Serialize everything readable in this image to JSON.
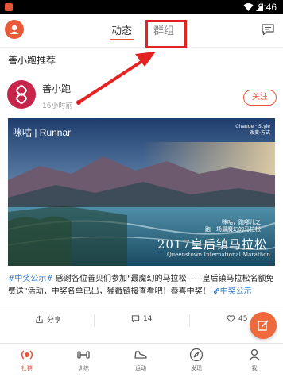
{
  "status_bar": {
    "time": "9:46"
  },
  "topbar": {
    "tabs": [
      {
        "label": "动态",
        "active": true
      },
      {
        "label": "群组",
        "active": false
      }
    ]
  },
  "section": {
    "title": "善小跑推荐"
  },
  "post": {
    "author": "善小跑",
    "time": "16小时前",
    "follow_label": "关注",
    "image": {
      "brand": "咪咕 | Runnar",
      "tagline": [
        "Change · Style",
        "改变·方式"
      ],
      "slogan": [
        "咪咕，跑哪儿之",
        "跑一场最魔幻的马拉松"
      ],
      "title": "2017皇后镇马拉松",
      "subtitle": "Queenstown International Marathon"
    },
    "text": {
      "hashtag": "#中奖公示#",
      "body": " 感谢各位善贝们参加\"最魔幻的马拉松——皇后镇马拉松名额免费送\"活动，中奖名单已出，猛戳链接查看吧！恭喜中奖！",
      "link": "中奖公示"
    },
    "actions": {
      "share_label": "分享",
      "comments": "14",
      "likes": "45"
    }
  },
  "bottom_nav": [
    {
      "label": "社群",
      "active": true
    },
    {
      "label": "训练",
      "active": false
    },
    {
      "label": "运动",
      "active": false
    },
    {
      "label": "发现",
      "active": false
    },
    {
      "label": "我",
      "active": false
    }
  ],
  "colors": {
    "accent": "#e8553a",
    "highlight": "#e52222",
    "link": "#2d78c8"
  }
}
